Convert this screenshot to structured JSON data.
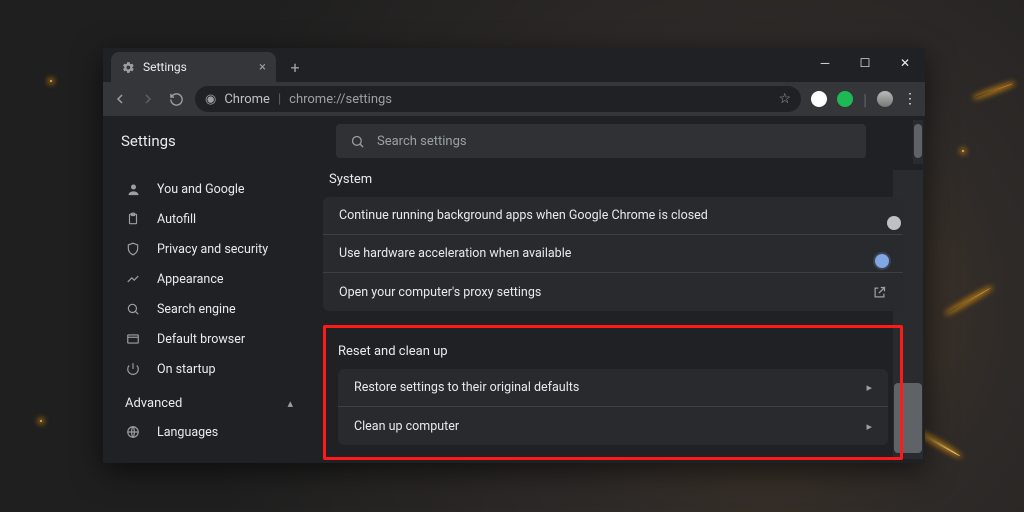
{
  "tab": {
    "title": "Settings"
  },
  "address": {
    "chip": "Chrome",
    "url": "chrome://settings"
  },
  "header": {
    "title": "Settings"
  },
  "search": {
    "placeholder": "Search settings"
  },
  "sidebar": {
    "items": [
      {
        "label": "You and Google"
      },
      {
        "label": "Autofill"
      },
      {
        "label": "Privacy and security"
      },
      {
        "label": "Appearance"
      },
      {
        "label": "Search engine"
      },
      {
        "label": "Default browser"
      },
      {
        "label": "On startup"
      }
    ],
    "advanced_label": "Advanced",
    "adv_items": [
      {
        "label": "Languages"
      }
    ]
  },
  "sections": {
    "system": {
      "title": "System",
      "rows": [
        {
          "label": "Continue running background apps when Google Chrome is closed"
        },
        {
          "label": "Use hardware acceleration when available"
        },
        {
          "label": "Open your computer's proxy settings"
        }
      ]
    },
    "reset": {
      "title": "Reset and clean up",
      "rows": [
        {
          "label": "Restore settings to their original defaults"
        },
        {
          "label": "Clean up computer"
        }
      ]
    }
  }
}
